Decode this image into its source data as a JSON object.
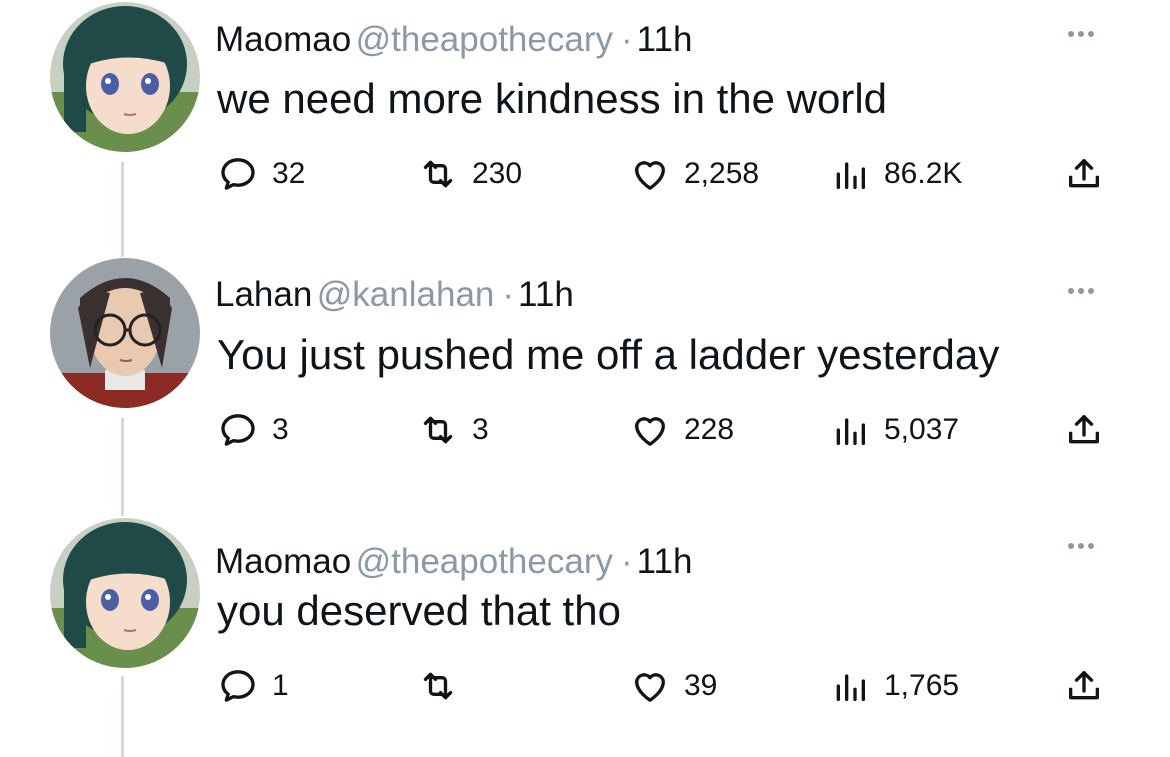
{
  "tweets": [
    {
      "name": "Maomao",
      "handle": "@theapothecary",
      "separator": "·",
      "time": "11h",
      "text": "we need more kindness in the world",
      "replies": "32",
      "retweets": "230",
      "likes": "2,258",
      "views": "86.2K",
      "avatar_icon": "maomao-avatar"
    },
    {
      "name": "Lahan",
      "handle": "@kanlahan",
      "separator": "·",
      "time": "11h",
      "text": "You just pushed me off a ladder yesterday",
      "replies": "3",
      "retweets": "3",
      "likes": "228",
      "views": "5,037",
      "avatar_icon": "lahan-avatar"
    },
    {
      "name": "Maomao",
      "handle": "@theapothecary",
      "separator": "·",
      "time": "11h",
      "text": "you deserved that tho",
      "replies": "1",
      "retweets": "",
      "likes": "39",
      "views": "1,765",
      "avatar_icon": "maomao-avatar"
    }
  ],
  "colors": {
    "text": "#0f1419",
    "secondary": "#8b98a5",
    "thread_line": "#cfd9de",
    "icon": "#53646f"
  }
}
